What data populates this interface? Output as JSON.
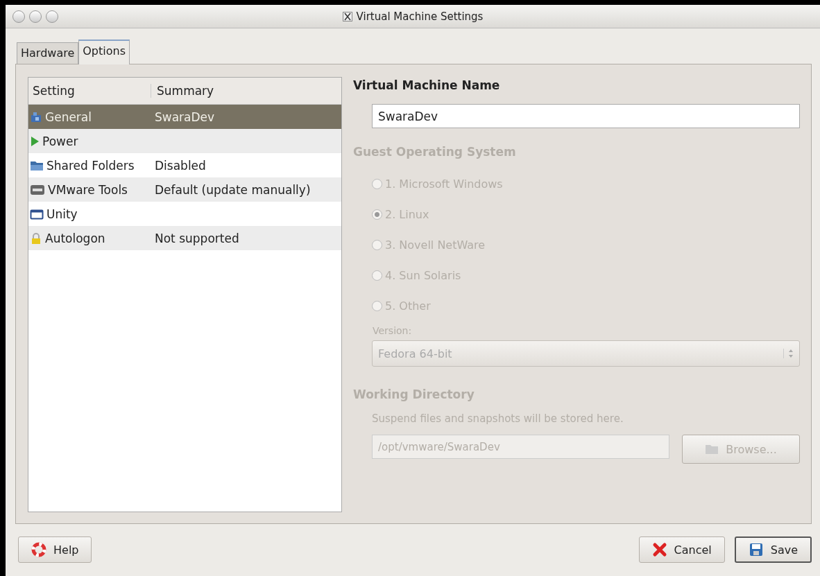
{
  "window": {
    "title": "Virtual Machine Settings"
  },
  "tabs": [
    {
      "label": "Hardware",
      "selected": false
    },
    {
      "label": "Options",
      "selected": true
    }
  ],
  "settings_list": {
    "columns": [
      "Setting",
      "Summary"
    ],
    "rows": [
      {
        "kind": "general",
        "setting": "General",
        "summary": "SwaraDev",
        "selected": true
      },
      {
        "kind": "power",
        "setting": "Power",
        "summary": "",
        "selected": false
      },
      {
        "kind": "folders",
        "setting": "Shared Folders",
        "summary": "Disabled",
        "selected": false
      },
      {
        "kind": "tools",
        "setting": "VMware Tools",
        "summary": "Default (update manually)",
        "selected": false
      },
      {
        "kind": "unity",
        "setting": "Unity",
        "summary": "",
        "selected": false
      },
      {
        "kind": "lock",
        "setting": "Autologon",
        "summary": "Not supported",
        "selected": false
      }
    ]
  },
  "name_section": {
    "heading": "Virtual Machine Name",
    "value": "SwaraDev"
  },
  "guest_os": {
    "heading": "Guest Operating System",
    "disabled": true,
    "options": [
      {
        "label": "1. Microsoft Windows",
        "selected": false
      },
      {
        "label": "2. Linux",
        "selected": true
      },
      {
        "label": "3. Novell NetWare",
        "selected": false
      },
      {
        "label": "4. Sun Solaris",
        "selected": false
      },
      {
        "label": "5. Other",
        "selected": false
      }
    ],
    "version_label": "Version:",
    "version_value": "Fedora 64-bit"
  },
  "working_directory": {
    "heading": "Working Directory",
    "disabled": true,
    "description": "Suspend files and snapshots will be stored here.",
    "path": "/opt/vmware/SwaraDev",
    "browse_button": "Browse..."
  },
  "buttons": [
    {
      "kind": "help",
      "label": "Help",
      "default": false
    },
    {
      "kind": "cancel",
      "label": "Cancel",
      "default": false
    },
    {
      "kind": "save",
      "label": "Save",
      "default": true
    }
  ]
}
